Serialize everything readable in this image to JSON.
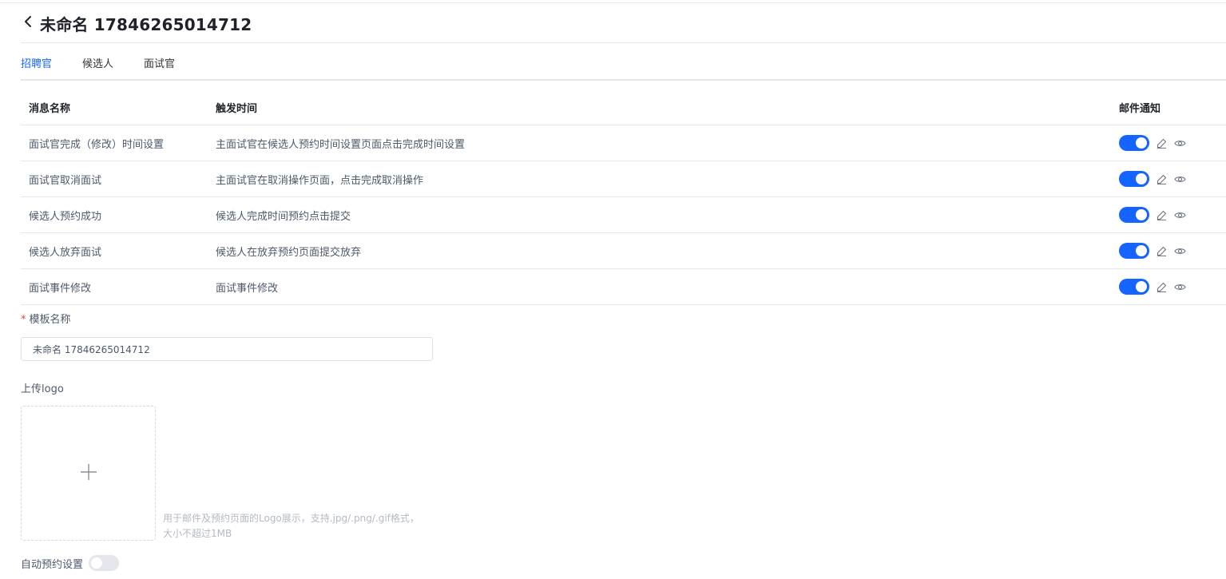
{
  "header": {
    "title": "未命名 17846265014712",
    "back_icon": "chevron-left-icon"
  },
  "tabs": [
    {
      "label": "招聘官",
      "active": true
    },
    {
      "label": "候选人",
      "active": false
    },
    {
      "label": "面试官",
      "active": false
    }
  ],
  "table": {
    "headers": {
      "name": "消息名称",
      "trigger": "触发时间",
      "email": "邮件通知"
    },
    "rows": [
      {
        "name": "面试官完成（修改）时间设置",
        "trigger": "主面试官在候选人预约时间设置页面点击完成时间设置",
        "email_enabled": true
      },
      {
        "name": "面试官取消面试",
        "trigger": "主面试官在取消操作页面，点击完成取消操作",
        "email_enabled": true
      },
      {
        "name": "候选人预约成功",
        "trigger": "候选人完成时间预约点击提交",
        "email_enabled": true
      },
      {
        "name": "候选人放弃面试",
        "trigger": "候选人在放弃预约页面提交放弃",
        "email_enabled": true
      },
      {
        "name": "面试事件修改",
        "trigger": "面试事件修改",
        "email_enabled": true
      }
    ],
    "row_icons": [
      "edit-icon",
      "eye-icon"
    ]
  },
  "form": {
    "template_name_label": "模板名称",
    "required_mark": "*",
    "template_name_value": "未命名 17846265014712",
    "upload_label": "上传logo",
    "upload_hint": "用于邮件及预约页面的Logo展示，支持.jpg/.png/.gif格式，大小不超过1MB",
    "auto_booking_label": "自动预约设置",
    "auto_booking_enabled": false
  },
  "colors": {
    "accent": "#1664ff",
    "text_primary": "#1f2329",
    "text_secondary": "#4e5969",
    "hint": "#b4b9c2",
    "required": "#f53f3f"
  }
}
